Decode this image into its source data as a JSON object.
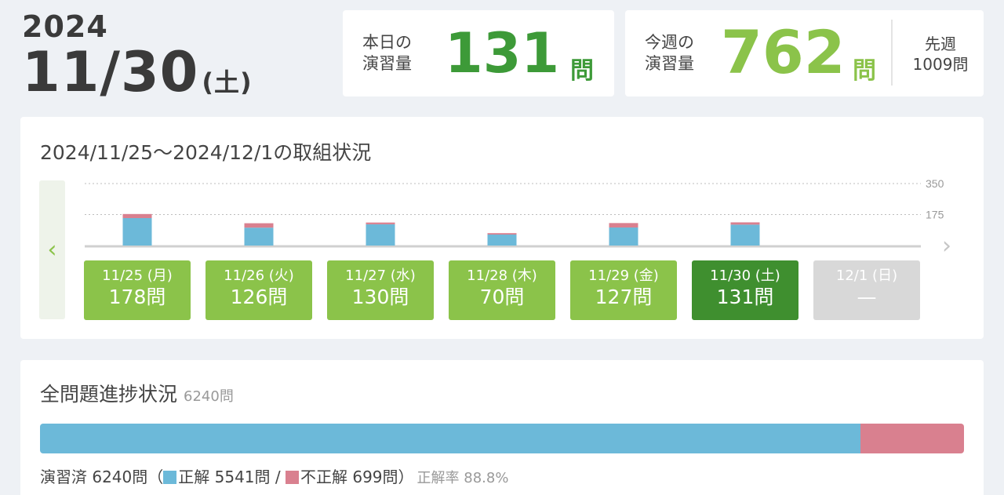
{
  "header": {
    "year": "2024",
    "month_day": "11/30",
    "weekday": "(土)"
  },
  "today": {
    "label_line1": "本日の",
    "label_line2": "演習量",
    "value": "131",
    "unit": "問"
  },
  "week": {
    "label_line1": "今週の",
    "label_line2": "演習量",
    "value": "762",
    "unit": "問",
    "last_week_label": "先週",
    "last_week_value": "1009問"
  },
  "week_panel": {
    "title": "2024/11/25〜2024/12/1の取組状況",
    "nav_prev_icon": "chevron-left-icon",
    "nav_next_icon": "chevron-right-icon",
    "colors": {
      "correct": "#6cb9d9",
      "incorrect": "#d9808f",
      "active": "#3f8f2f",
      "normal": "#8bc34a",
      "disabled": "#d8d8d8"
    }
  },
  "chart_data": {
    "type": "bar",
    "stacked": true,
    "categories": [
      "11/25",
      "11/26",
      "11/27",
      "11/28",
      "11/29",
      "11/30",
      "12/1"
    ],
    "series": [
      {
        "values": [
          155,
          101,
          120,
          62,
          102,
          118,
          0
        ]
      },
      {
        "values": [
          23,
          25,
          10,
          8,
          25,
          13,
          0
        ]
      }
    ],
    "y_ticks": [
      "350",
      "175"
    ],
    "ylim": [
      0,
      350
    ],
    "grid": true
  },
  "days": [
    {
      "date": "11/25",
      "dow": "(月)",
      "count": "178問",
      "state": "normal"
    },
    {
      "date": "11/26",
      "dow": "(火)",
      "count": "126問",
      "state": "normal"
    },
    {
      "date": "11/27",
      "dow": "(水)",
      "count": "130問",
      "state": "normal"
    },
    {
      "date": "11/28",
      "dow": "(木)",
      "count": "70問",
      "state": "normal"
    },
    {
      "date": "11/29",
      "dow": "(金)",
      "count": "127問",
      "state": "normal"
    },
    {
      "date": "11/30",
      "dow": "(土)",
      "count": "131問",
      "state": "active"
    },
    {
      "date": "12/1",
      "dow": "(日)",
      "count": "—",
      "state": "disabled"
    }
  ],
  "progress": {
    "title": "全問題進捗状況",
    "total": "6240問",
    "done_label": "演習済 6240問（",
    "correct_label": "正解 5541問 / ",
    "incorrect_label": "不正解 699問）",
    "rate_label": "正解率 88.8%",
    "correct_fraction": 0.888,
    "incorrect_fraction": 0.112
  }
}
